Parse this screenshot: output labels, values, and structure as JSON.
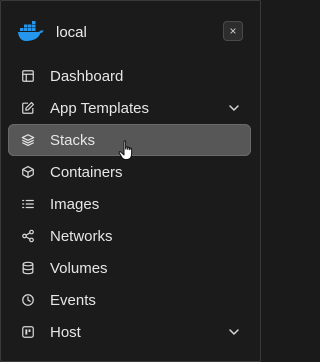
{
  "header": {
    "environment_name": "local",
    "logo_icon": "docker-whale-icon",
    "close_label": "×"
  },
  "menu": {
    "items": [
      {
        "label": "Dashboard",
        "icon": "layout-icon",
        "expandable": false,
        "active": false
      },
      {
        "label": "App Templates",
        "icon": "edit-icon",
        "expandable": true,
        "active": false
      },
      {
        "label": "Stacks",
        "icon": "layers-icon",
        "expandable": false,
        "active": true
      },
      {
        "label": "Containers",
        "icon": "box-icon",
        "expandable": false,
        "active": false
      },
      {
        "label": "Images",
        "icon": "list-icon",
        "expandable": false,
        "active": false
      },
      {
        "label": "Networks",
        "icon": "share-icon",
        "expandable": false,
        "active": false
      },
      {
        "label": "Volumes",
        "icon": "database-icon",
        "expandable": false,
        "active": false
      },
      {
        "label": "Events",
        "icon": "clock-icon",
        "expandable": false,
        "active": false
      },
      {
        "label": "Host",
        "icon": "host-icon",
        "expandable": true,
        "active": false
      }
    ]
  },
  "colors": {
    "background": "#1b1b1b",
    "active_item": "#575757",
    "docker_blue": "#2496ed",
    "text": "#e6e6e6"
  }
}
